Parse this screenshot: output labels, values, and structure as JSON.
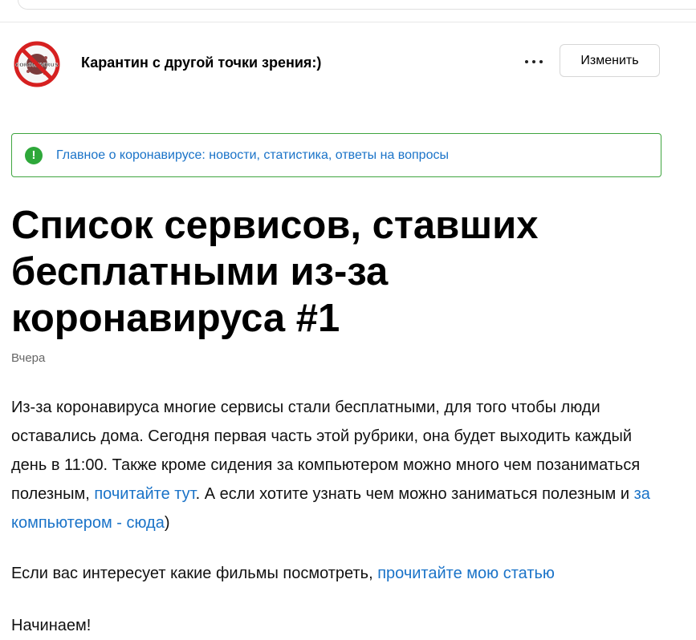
{
  "header": {
    "channel_title": "Карантин с другой точки зрения:)",
    "avatar_text": "CORONAVIRUS",
    "edit_label": "Изменить"
  },
  "notice": {
    "text": "Главное о коронавирусе: новости, статистика, ответы на вопросы",
    "icon": "exclamation-icon",
    "icon_glyph": "!"
  },
  "article": {
    "title": "Список сервисов, ставших бесплатными из-за коронавируса #1",
    "date": "Вчера",
    "p1": {
      "text_a": "Из-за коронавируса многие сервисы стали бесплатными, для того чтобы люди оставались дома. Сегодня первая часть этой рубрики, она будет выходить каждый день в 11:00. Также кроме сидения за компьютером можно много чем позаниматься полезным, ",
      "link_a": "почитайте тут",
      "text_b": ". А если хотите узнать чем можно заниматься полезным и ",
      "link_b": "за компьютером - сюда",
      "text_c": ")"
    },
    "p2": {
      "text_a": "Если вас интересует какие фильмы посмотреть, ",
      "link_a": "прочитайте мою статью"
    },
    "p3": {
      "text_a": "Начинаем!"
    }
  },
  "colors": {
    "link": "#1a73c8",
    "notice_border": "#3fa53f",
    "notice_icon": "#2ea83a"
  }
}
